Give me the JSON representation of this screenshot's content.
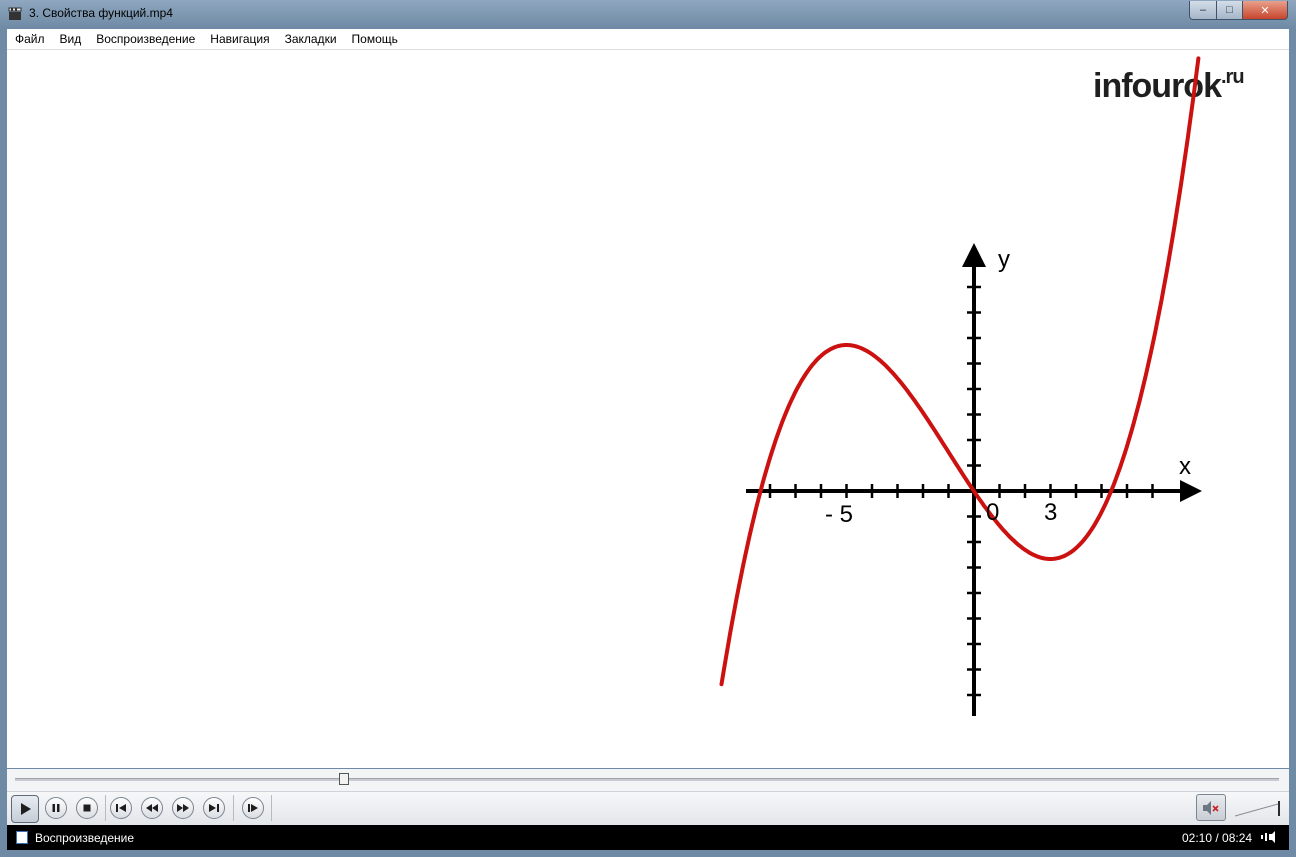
{
  "window": {
    "title": "3. Свойства функций.mp4",
    "min_label": "‒",
    "max_label": "□",
    "close_label": "✕"
  },
  "menu": {
    "items": [
      "Файл",
      "Вид",
      "Воспроизведение",
      "Навигация",
      "Закладки",
      "Помощь"
    ]
  },
  "video": {
    "logo_main": "infourok",
    "logo_suffix": ".ru",
    "graph": {
      "x_axis_label": "x",
      "y_axis_label": "y",
      "tick_label_neg5": "- 5",
      "tick_label_0": "0",
      "tick_label_3": "3",
      "curve_color": "#cc1111"
    }
  },
  "playback": {
    "position_fraction": 0.26
  },
  "status": {
    "text": "Воспроизведение",
    "time": "02:10 / 08:24"
  },
  "colors": {
    "accent_curve": "#cc1111",
    "status_bg": "#000000",
    "frame": "#6f8aa5"
  },
  "icons": {
    "play": "play-icon",
    "pause": "pause-icon",
    "stop": "stop-icon",
    "prev": "skip-previous-icon",
    "rewind": "rewind-icon",
    "forward": "fast-forward-icon",
    "next": "skip-next-icon",
    "frame_step": "frame-step-icon",
    "mute": "speaker-muted-icon"
  }
}
